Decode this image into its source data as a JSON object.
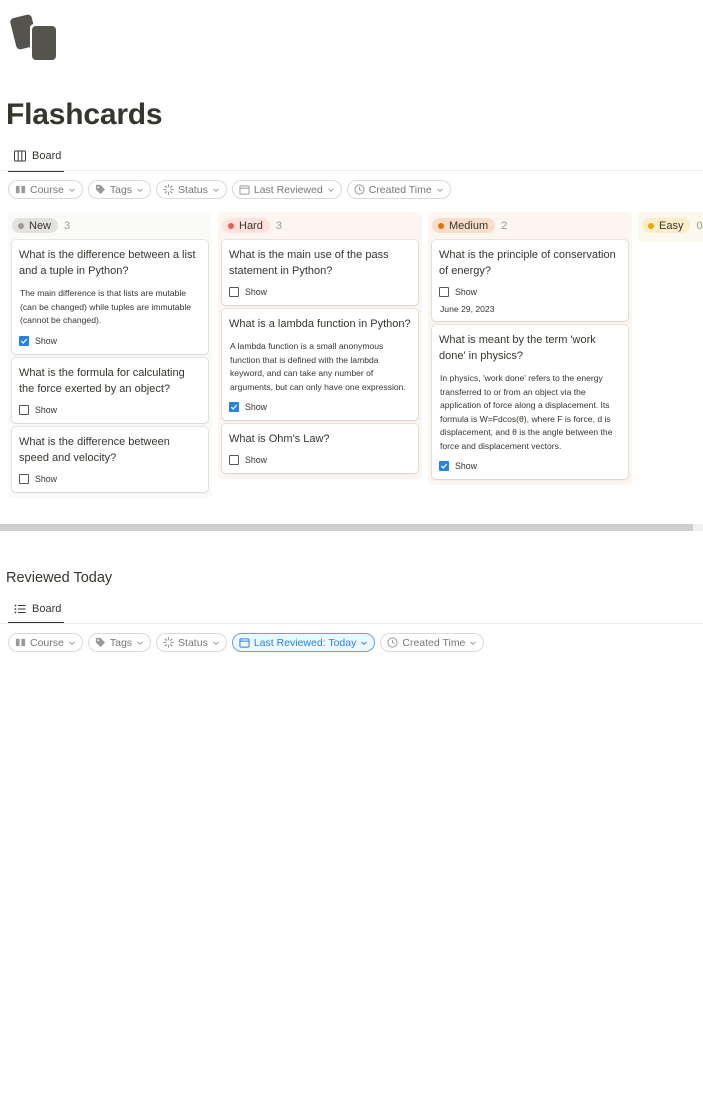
{
  "page": {
    "icon": "flashcards-icon",
    "title": "Flashcards"
  },
  "main_view": {
    "tab_label": "Board",
    "tab_icon": "board-icon",
    "filters": [
      {
        "label": "Course",
        "icon": "book-icon"
      },
      {
        "label": "Tags",
        "icon": "tag-icon"
      },
      {
        "label": "Status",
        "icon": "status-icon"
      },
      {
        "label": "Last Reviewed",
        "icon": "calendar-icon"
      },
      {
        "label": "Created Time",
        "icon": "clock-icon"
      }
    ]
  },
  "board": {
    "columns": [
      {
        "label": "New",
        "count": "3",
        "dot_color": "#9b9a97",
        "pill_bg": "#e3e2e0",
        "col_bg": "#fafaf9",
        "cards": [
          {
            "question": "What is the difference between a list and a tuple in Python?",
            "answer": "The main difference is that lists are mutable (can be changed) while tuples are immutable (cannot be changed).",
            "show_label": "Show",
            "checked": true
          },
          {
            "question": "What is the formula for calculating the force exerted by an object?",
            "show_label": "Show",
            "checked": false
          },
          {
            "question": "What is the difference between speed and velocity?",
            "show_label": "Show",
            "checked": false
          }
        ]
      },
      {
        "label": "Hard",
        "count": "3",
        "dot_color": "#e16259",
        "pill_bg": "#ffe2dd",
        "col_bg": "#fdf5f2",
        "cards": [
          {
            "question": "What is the main use of the pass statement in Python?",
            "show_label": "Show",
            "checked": false
          },
          {
            "question": "What is a lambda function in Python?",
            "answer": "A lambda function is a small anonymous function that is defined with the lambda keyword, and can take any number of arguments, but can only have one expression.",
            "show_label": "Show",
            "checked": true
          },
          {
            "question": "What is Ohm's Law?",
            "show_label": "Show",
            "checked": false
          }
        ]
      },
      {
        "label": "Medium",
        "count": "2",
        "dot_color": "#d9730d",
        "pill_bg": "#fadec9",
        "col_bg": "#fcf6f0",
        "cards": [
          {
            "question": "What is the principle of conservation of energy?",
            "show_label": "Show",
            "checked": false,
            "date": "June 29, 2023"
          },
          {
            "question": "What is meant by the term 'work done' in physics?",
            "answer": "In physics, 'work done' refers to the energy transferred to or from an object via the application of force along a displacement. Its formula is W=Fdcos(θ), where F is force, d is displacement, and θ is the angle between the force and displacement vectors.",
            "show_label": "Show",
            "checked": true
          }
        ]
      },
      {
        "label": "Easy",
        "count": "0",
        "dot_color": "#dfab01",
        "pill_bg": "#fdecc8",
        "col_bg": "#fbf8ee",
        "cards": []
      }
    ]
  },
  "reviewed_section": {
    "title": "Reviewed Today",
    "tab_label": "Board",
    "tab_icon": "list-icon",
    "filters": [
      {
        "label": "Course",
        "icon": "book-icon"
      },
      {
        "label": "Tags",
        "icon": "tag-icon"
      },
      {
        "label": "Status",
        "icon": "status-icon"
      },
      {
        "label": "Last Reviewed: Today",
        "icon": "calendar-icon",
        "active": true
      },
      {
        "label": "Created Time",
        "icon": "clock-icon"
      }
    ]
  },
  "colors": {
    "accent": "#2383e2",
    "text": "#37352f",
    "muted": "#787774"
  }
}
